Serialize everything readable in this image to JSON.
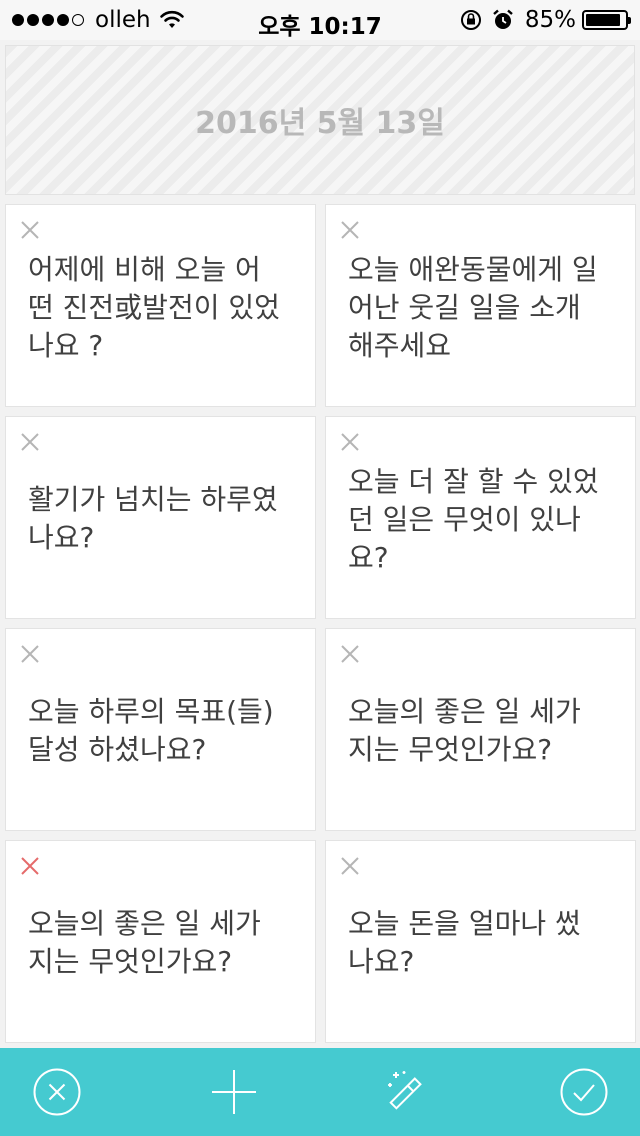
{
  "status_bar": {
    "carrier": "olleh",
    "time": "오후 10:17",
    "battery": "85%",
    "signal_icon": "signal-dots-icon",
    "wifi_icon": "wifi-icon"
  },
  "date_header": "2016년 5월 13일",
  "cards": [
    {
      "question": "어제에 비해 오늘 어\n떤 진전或발전이 있었\n나요 ?",
      "highlight": false
    },
    {
      "question": "오늘 애완동물에게 일\n어난 웃길 일을 소개\n해주세요",
      "highlight": false
    },
    {
      "question": "활기가 넘치는 하루였\n나요?",
      "highlight": false
    },
    {
      "question": "오늘 더 잘 할 수 있었\n던 일은 무엇이 있나\n요?",
      "highlight": false
    },
    {
      "question": "오늘 하루의 목표(들)\n달성 하셨나요?",
      "highlight": false
    },
    {
      "question": "오늘의 좋은 일 세가\n지는 무엇인가요?",
      "highlight": false
    },
    {
      "question": "오늘의 좋은 일 세가\n지는 무엇인가요?",
      "highlight": true
    },
    {
      "question": "오늘 돈을 얼마나 썼\n나요?",
      "highlight": false
    }
  ],
  "colors": {
    "accent": "#45cad0",
    "close_gray": "#b5b5b5",
    "close_red": "#e56b6b",
    "date_text": "#b8b8b8",
    "question_text": "#404040"
  },
  "toolbar": {
    "icons": [
      "cancel-circle-icon",
      "plus-icon",
      "magic-wand-icon",
      "check-circle-icon"
    ]
  }
}
